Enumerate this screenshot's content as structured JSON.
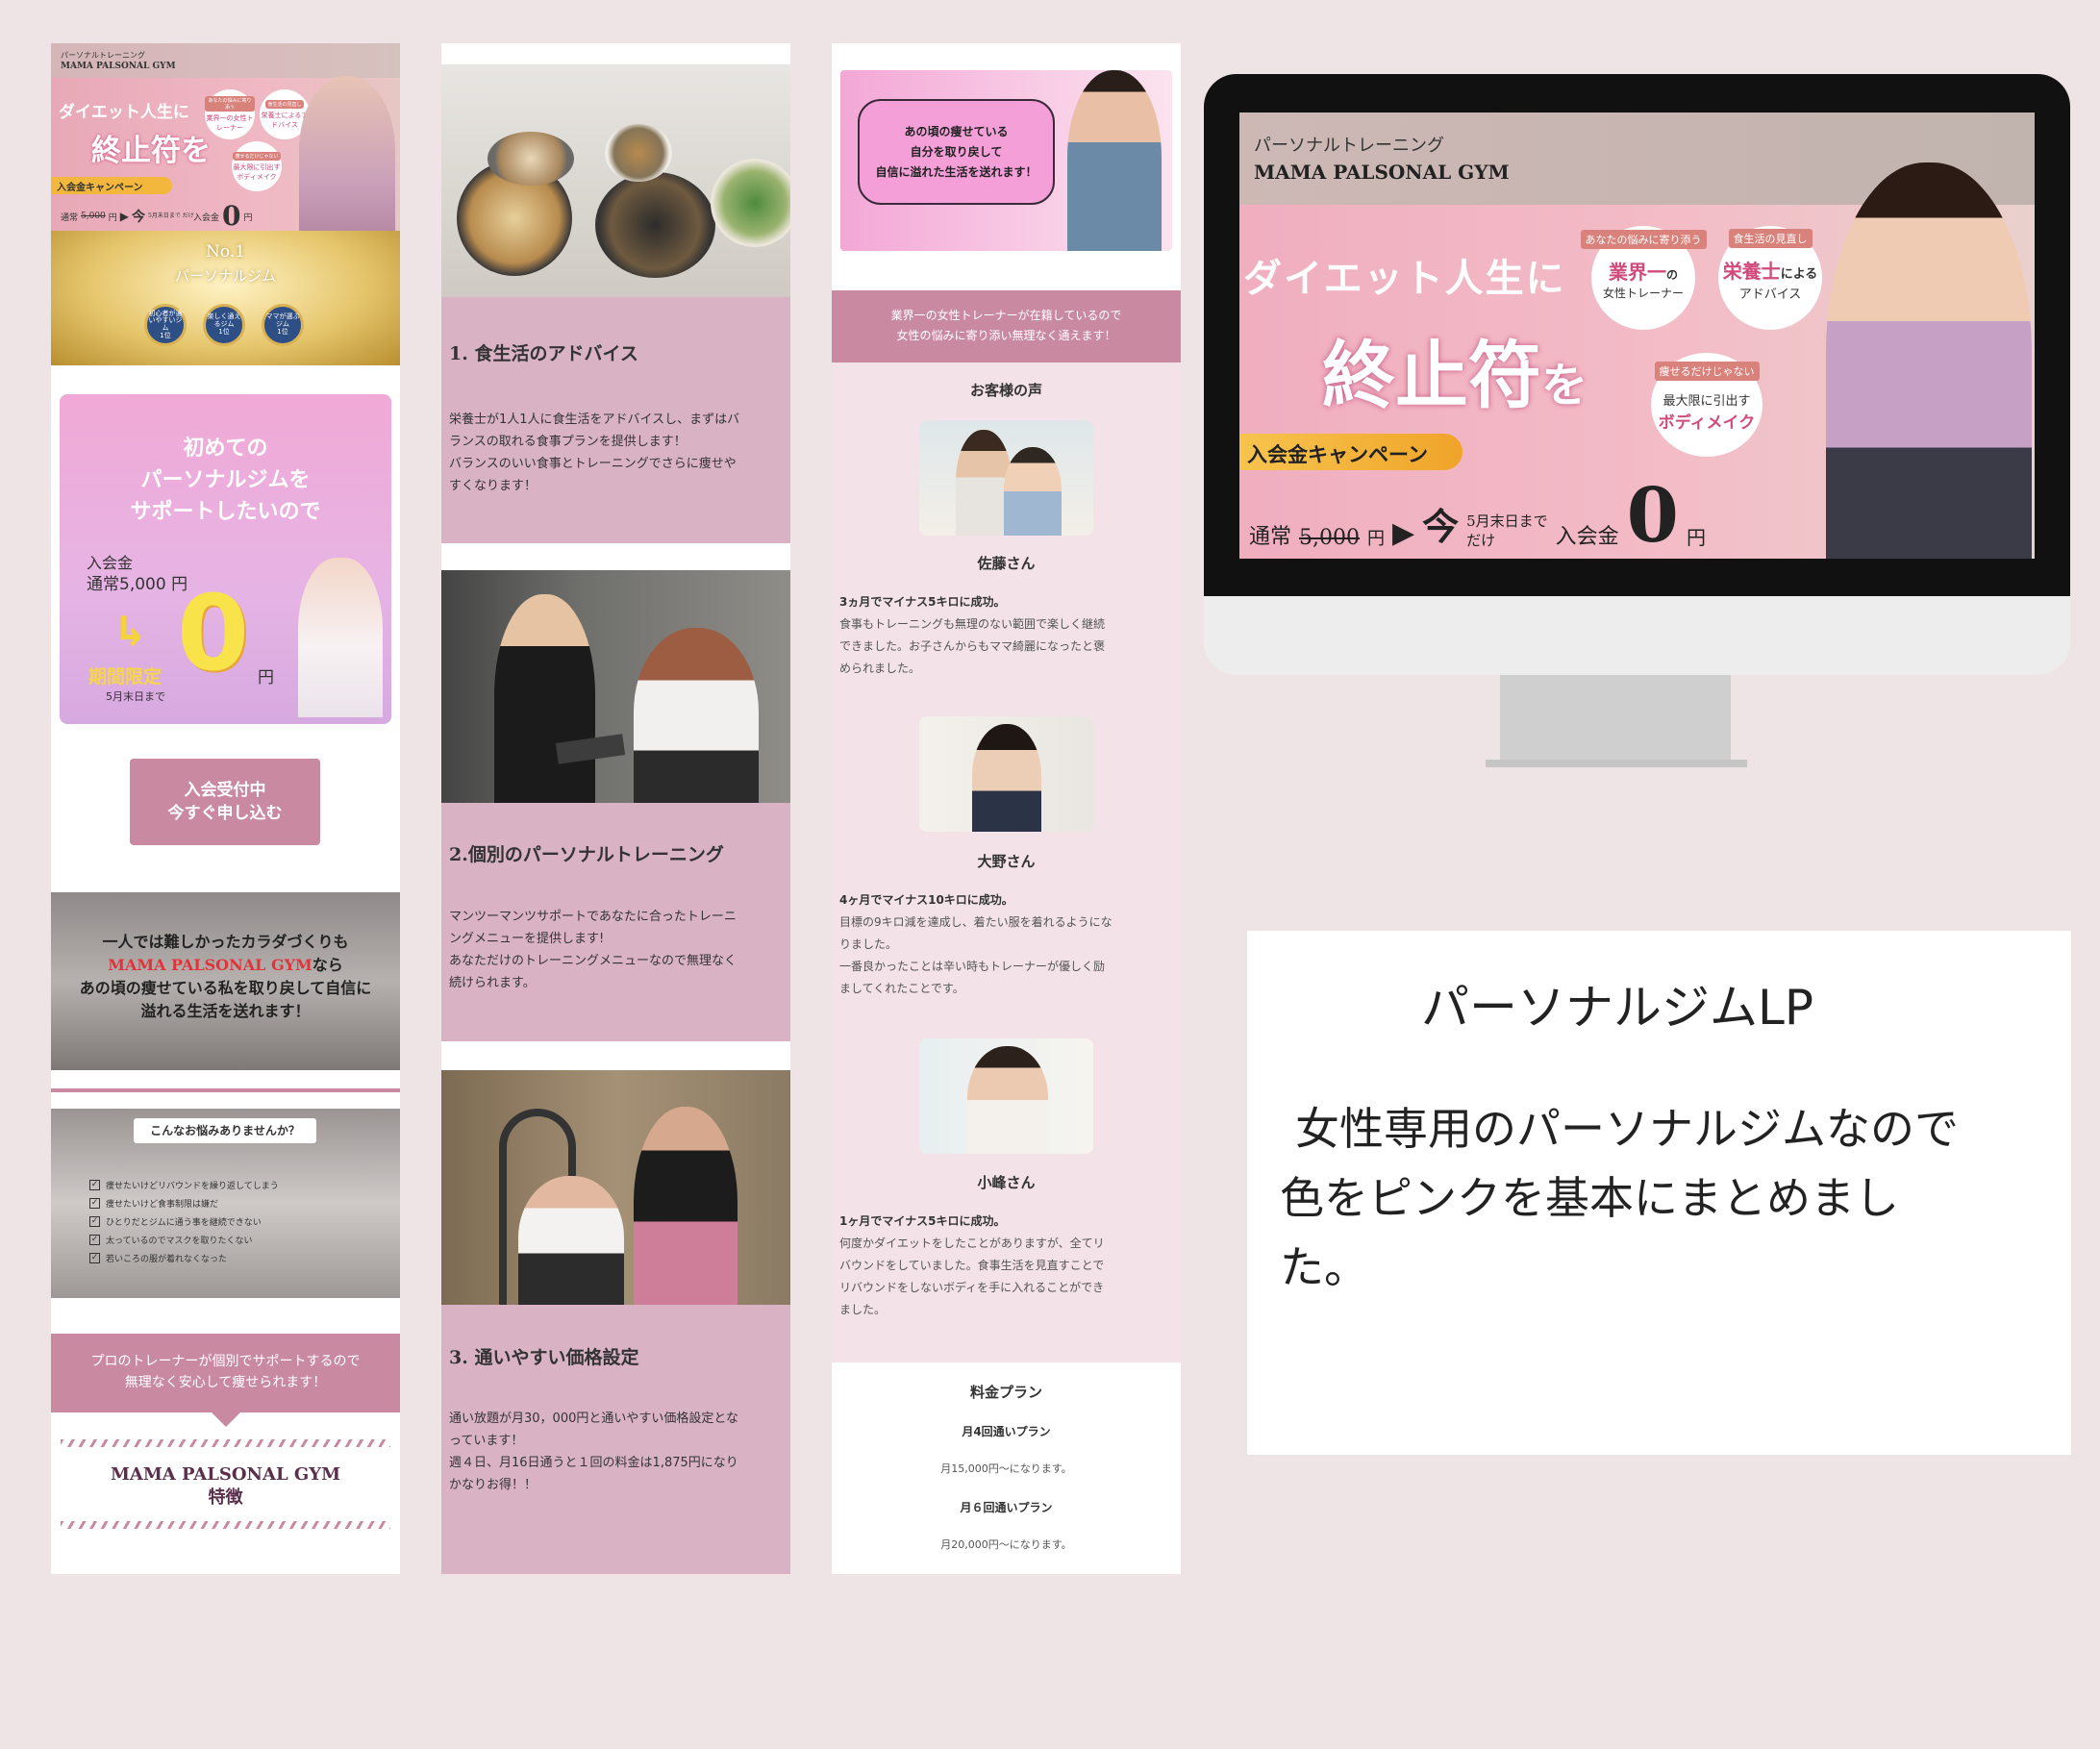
{
  "col1": {
    "hero": {
      "subtitle": "パーソナルトレーニング",
      "brand": "MAMA PALSONAL GYM",
      "line1": "ダイエット人生に",
      "line2": "終止符を",
      "badge1_tag": "あなたの悩みに寄り添う",
      "badge1_text": "業界一の女性トレーナー",
      "badge2_tag": "食生活の見直し",
      "badge2_text": "栄養士によるアドバイス",
      "badge3_tag": "痩せるだけじゃない",
      "badge3_text": "最大限に引出すボディメイク",
      "campaign": "入会金キャンペーン",
      "normal": "通常",
      "old_price": "5,000",
      "yen": "円",
      "now": "今",
      "until": "5月末日まで",
      "only": "だけ",
      "fee": "入会金",
      "zero": "0",
      "yen2": "円"
    },
    "no1": {
      "title": "No.1",
      "sub": "パーソナルジム",
      "medal1": "初心者が通いやすいジム",
      "medal1_rank": "1位",
      "medal2": "楽しく通えるジム",
      "medal2_rank": "1位",
      "medal3": "ママが選ぶジム",
      "medal3_rank": "1位"
    },
    "promo": {
      "l1": "初めての",
      "l2": "パーソナルジムを",
      "l3": "サポートしたいので",
      "fee_label": "入会金",
      "normal": "通常5,000 円",
      "limited": "期間限定",
      "deadline": "5月末日まで",
      "zero": "0",
      "yen": "円"
    },
    "button": {
      "l1": "入会受付中",
      "l2": "今すぐ申し込む"
    },
    "gym_msg": {
      "l1": "一人では難しかったカラダづくりも",
      "brand": "MAMA PALSONAL GYM",
      "nara": "なら",
      "l3": "あの頃の痩せている私を取り戻して自信に",
      "l4": "溢れる生活を送れます！"
    },
    "worries": {
      "title": "こんなお悩みありませんか？",
      "items": [
        "痩せたいけどリバウンドを繰り返してしまう",
        "痩せたいけど食事制限は嫌だ",
        "ひとりだとジムに通う事を継続できない",
        "太っているのでマスクを取りたくない",
        "若いころの服が着れなくなった"
      ]
    },
    "pro": {
      "l1": "プロのトレーナーが個別でサポートするので",
      "l2": "無理なく安心して痩せられます！"
    },
    "features": {
      "brand": "MAMA PALSONAL GYM",
      "label": "特徴"
    }
  },
  "col2": {
    "f1_title": "1.  食生活のアドバイス",
    "f1_body": [
      "栄養士が1人1人に食生活をアドバイスし、まずはバ",
      "ランスの取れる食事プランを提供します！",
      "バランスのいい食事とトレーニングでさらに痩せや",
      "すくなります！"
    ],
    "f2_title": "2.個別のパーソナルトレーニング",
    "f2_body": [
      "マンツーマンツサポートであなたに合ったトレーニ",
      "ングメニューを提供します!",
      "あなただけのトレーニングメニューなので無理なく",
      "続けられます。"
    ],
    "f3_title": "3.  通いやすい価格設定",
    "f3_body": [
      "通い放題が月30，000円と通いやすい価格設定とな",
      "っています！",
      "週４日、月16日通うと１回の料金は1,875円になり",
      "かなりお得！！"
    ]
  },
  "col3": {
    "top": {
      "l1": "あの頃の痩せている",
      "l2": "自分を取り戻して",
      "l3": "自信に溢れた生活を送れます！"
    },
    "banner": {
      "l1": "業界一の女性トレーナーが在籍しているので",
      "l2": "女性の悩みに寄り添い無理なく通えます！"
    },
    "voices_title": "お客様の声",
    "voices": [
      {
        "name": "佐藤さん",
        "head": "3ヵ月でマイナス5キロに成功。",
        "body": [
          "食事もトレーニングも無理のない範囲で楽しく継続",
          "できました。お子さんからもママ綺麗になったと褒",
          "められました。"
        ]
      },
      {
        "name": "大野さん",
        "head": "4ヶ月でマイナス10キロに成功。",
        "body": [
          "目標の9キロ減を達成し、着たい服を着れるようにな",
          "りました。",
          "一番良かったことは辛い時もトレーナーが優しく励",
          "ましてくれたことです。"
        ]
      },
      {
        "name": "小峰さん",
        "head": "1ヶ月でマイナス5キロに成功。",
        "body": [
          "何度かダイエットをしたことがありますが、全てリ",
          "バウンドをしていました。食事生活を見直すことで",
          "リバウンドをしないボディを手に入れることができ",
          "ました。"
        ]
      }
    ],
    "plan_title": "料金プラン",
    "plans": [
      {
        "name": "月4回通いプラン",
        "price": "月15,000円～になります。"
      },
      {
        "name": "月６回通いプラン",
        "price": "月20,000円～になります。"
      }
    ]
  },
  "desktop": {
    "subtitle": "パーソナルトレーニング",
    "brand": "MAMA PALSONAL GYM",
    "line1": "ダイエット人生に",
    "line2a": "終止符",
    "line2b": "を",
    "badge1_tag": "あなたの悩みに寄り添う",
    "badge1_main": "業界一",
    "badge1_no": "の",
    "badge1_sub": "女性トレーナー",
    "badge2_tag": "食生活の見直し",
    "badge2_main": "栄養士",
    "badge2_niyoru": "による",
    "badge2_sub": "アドバイス",
    "badge3_tag": "痩せるだけじゃない",
    "badge3_main": "最大限に引出す",
    "badge3_sub": "ボディメイク",
    "campaign": "入会金キャンペーン",
    "normal": "通常",
    "old_price": "5,000",
    "yen": "円",
    "now": "今",
    "until": "5月末日まで",
    "only": "だけ",
    "fee": "入会金",
    "zero": "0",
    "yen2": "円"
  },
  "caption": {
    "title": "パーソナルジムLP",
    "body1": "女性専用のパーソナルジムなので",
    "body2": "色をピンクを基本にまとめまし",
    "body3": "た。"
  },
  "colors": {
    "accent": "#c98aa1",
    "pink_bg": "#d9b3c4",
    "page_bg": "#efe4e5"
  }
}
